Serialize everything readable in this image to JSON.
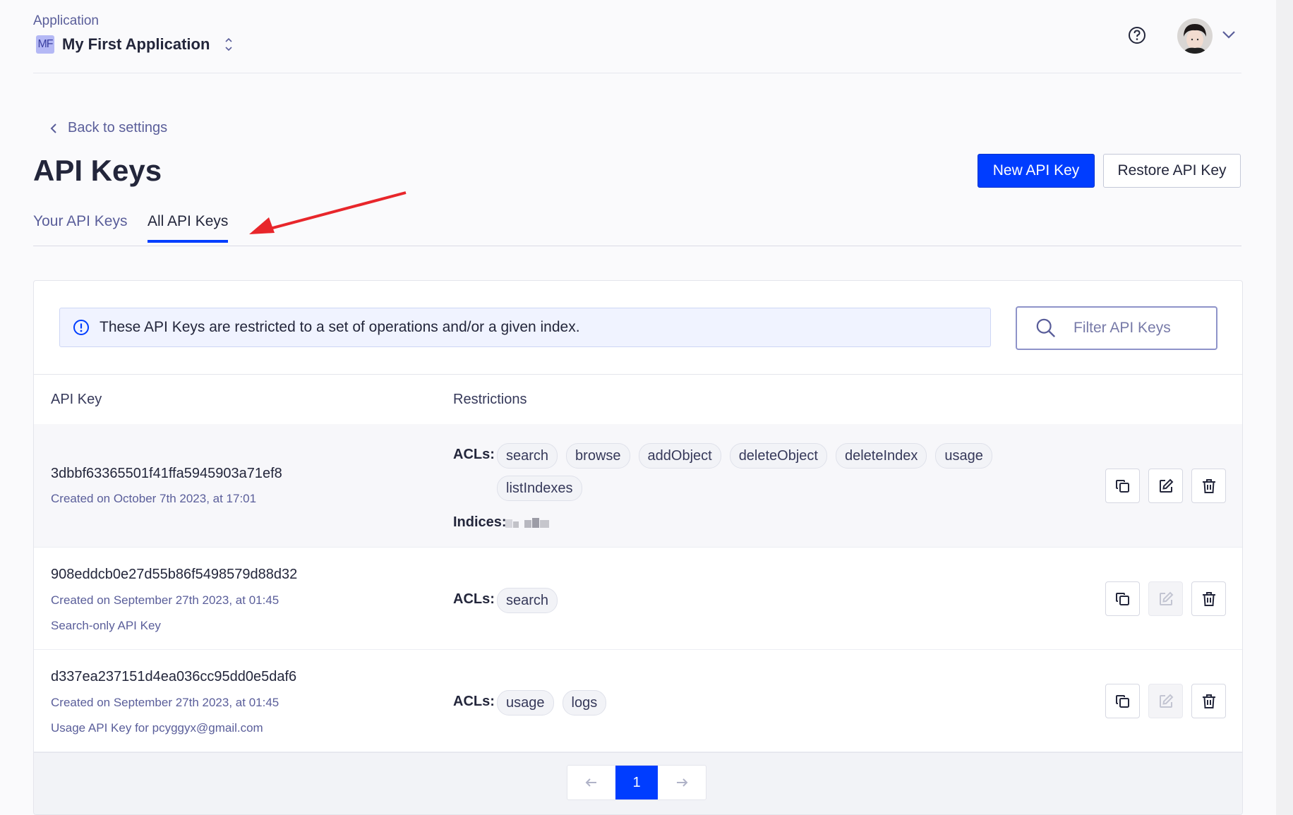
{
  "app": {
    "caption": "Application",
    "avatar_initials": "MF",
    "name": "My First Application"
  },
  "header": {
    "back_label": "Back to settings",
    "title": "API Keys",
    "new_key_label": "New API Key",
    "restore_key_label": "Restore API Key"
  },
  "tabs": [
    {
      "label": "Your API Keys",
      "active": false
    },
    {
      "label": "All API Keys",
      "active": true
    }
  ],
  "info_banner": "These API Keys are restricted to a set of operations and/or a given index.",
  "filter": {
    "placeholder": "Filter API Keys"
  },
  "table": {
    "columns": [
      "API Key",
      "Restrictions"
    ],
    "acl_label": "ACLs:",
    "indices_label": "Indices:",
    "rows": [
      {
        "key": "3dbbf63365501f41ffa5945903a71ef8",
        "created": "Created on October 7th 2023, at 17:01",
        "description": "",
        "acls": [
          "search",
          "browse",
          "addObject",
          "deleteObject",
          "deleteIndex",
          "usage",
          "listIndexes"
        ],
        "edit_enabled": true
      },
      {
        "key": "908eddcb0e27d55b86f5498579d88d32",
        "created": "Created on September 27th 2023, at 01:45",
        "description": "Search-only API Key",
        "acls": [
          "search"
        ],
        "edit_enabled": false
      },
      {
        "key": "d337ea237151d4ea036cc95dd0e5daf6",
        "created": "Created on September 27th 2023, at 01:45",
        "description": "Usage API Key for pcyggyx@gmail.com",
        "acls": [
          "usage",
          "logs"
        ],
        "edit_enabled": false
      }
    ]
  },
  "pagination": {
    "current_page": "1"
  },
  "colors": {
    "accent": "#003dff",
    "annotation_arrow": "#e8262b"
  },
  "icons": [
    "updown-icon",
    "help-icon",
    "chevron-down-icon",
    "chevron-left-icon",
    "info-icon",
    "search-icon",
    "copy-icon",
    "edit-icon",
    "trash-icon",
    "arrow-left-icon",
    "arrow-right-icon"
  ]
}
